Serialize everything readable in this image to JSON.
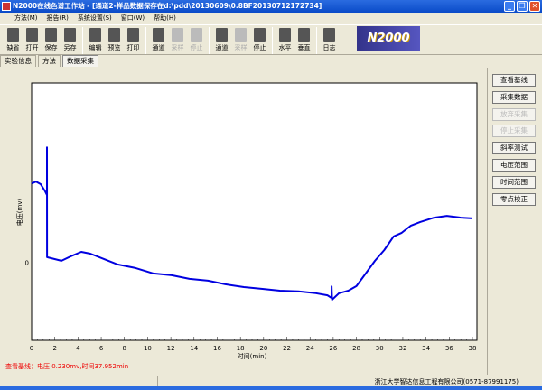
{
  "window": {
    "title": "N2000在线色谱工作站 - [通道2-样品数据保存在d:\\pdd\\20130609\\0.8BF20130712172734]",
    "min": "_",
    "max": "❐",
    "close": "✕"
  },
  "menu": [
    "方法(M)",
    "报告(R)",
    "系统设置(S)",
    "窗口(W)",
    "帮助(H)"
  ],
  "toolbar": {
    "groups": [
      [
        {
          "label": "缺省",
          "enabled": true
        },
        {
          "label": "打开",
          "enabled": true
        },
        {
          "label": "保存",
          "enabled": true
        },
        {
          "label": "另存",
          "enabled": true
        }
      ],
      [
        {
          "label": "编辑",
          "enabled": true
        },
        {
          "label": "预览",
          "enabled": true
        },
        {
          "label": "打印",
          "enabled": true
        }
      ],
      [
        {
          "label": "通道",
          "enabled": true
        },
        {
          "label": "采样",
          "enabled": false
        },
        {
          "label": "停止",
          "enabled": false
        }
      ],
      [
        {
          "label": "通道",
          "enabled": true
        },
        {
          "label": "采样",
          "enabled": false
        },
        {
          "label": "停止",
          "enabled": true
        }
      ],
      [
        {
          "label": "水平",
          "enabled": true
        },
        {
          "label": "垂直",
          "enabled": true
        }
      ],
      [
        {
          "label": "日志",
          "enabled": true
        }
      ]
    ],
    "logo": "N2000"
  },
  "tabs": [
    "实验信息",
    "方法",
    "数据采集"
  ],
  "active_tab": "数据采集",
  "side_buttons": [
    {
      "label": "查看基线",
      "enabled": true
    },
    {
      "label": "采集数据",
      "enabled": true
    },
    {
      "label": "放弃采集",
      "enabled": false
    },
    {
      "label": "停止采集",
      "enabled": false
    },
    {
      "label": "斜率测试",
      "enabled": true
    },
    {
      "label": "电压范围",
      "enabled": true
    },
    {
      "label": "时间范围",
      "enabled": true
    },
    {
      "label": "零点校正",
      "enabled": true
    }
  ],
  "status_text": "查看基线：电压 0.230mv,时间37.952min",
  "statusbar": {
    "company": "浙江大学智达信息工程有限公司(0571-87991175)"
  },
  "chart_data": {
    "type": "line",
    "xlabel": "时间(min)",
    "ylabel": "电压(mv)",
    "xlim": [
      0,
      38
    ],
    "ylim": [
      -0.3,
      0.7
    ],
    "xticks": [
      0,
      2,
      4,
      6,
      8,
      10,
      12,
      14,
      16,
      18,
      20,
      22,
      24,
      26,
      28,
      30,
      32,
      34,
      36,
      38
    ],
    "yticks": [
      0
    ],
    "color": "#0000e0",
    "series": [
      {
        "name": "通道2",
        "points": [
          [
            0,
            0.31
          ],
          [
            0.39,
            0.317
          ],
          [
            0.78,
            0.307
          ],
          [
            1.17,
            0.279
          ],
          [
            1.32,
            0.265
          ],
          [
            1.32,
            0.45
          ],
          [
            1.33,
            0.023
          ],
          [
            1.95,
            0.016
          ],
          [
            2.57,
            0.009
          ],
          [
            3.35,
            0.026
          ],
          [
            4.28,
            0.044
          ],
          [
            5.06,
            0.037
          ],
          [
            6.23,
            0.016
          ],
          [
            7.4,
            -0.005
          ],
          [
            8.96,
            -0.019
          ],
          [
            10.5,
            -0.04
          ],
          [
            12.07,
            -0.047
          ],
          [
            13.6,
            -0.061
          ],
          [
            15.2,
            -0.068
          ],
          [
            16.7,
            -0.082
          ],
          [
            18.3,
            -0.093
          ],
          [
            19.9,
            -0.1
          ],
          [
            21.4,
            -0.107
          ],
          [
            23.0,
            -0.11
          ],
          [
            24.5,
            -0.117
          ],
          [
            25.5,
            -0.125
          ],
          [
            25.85,
            -0.135
          ],
          [
            25.86,
            -0.09
          ],
          [
            25.9,
            -0.142
          ],
          [
            26.5,
            -0.117
          ],
          [
            27.3,
            -0.107
          ],
          [
            28.0,
            -0.089
          ],
          [
            28.8,
            -0.04
          ],
          [
            29.6,
            0.009
          ],
          [
            30.4,
            0.051
          ],
          [
            31.2,
            0.104
          ],
          [
            31.9,
            0.118
          ],
          [
            32.7,
            0.146
          ],
          [
            33.5,
            0.16
          ],
          [
            34.7,
            0.177
          ],
          [
            35.8,
            0.184
          ],
          [
            37.0,
            0.177
          ],
          [
            38,
            0.174
          ]
        ]
      }
    ]
  }
}
